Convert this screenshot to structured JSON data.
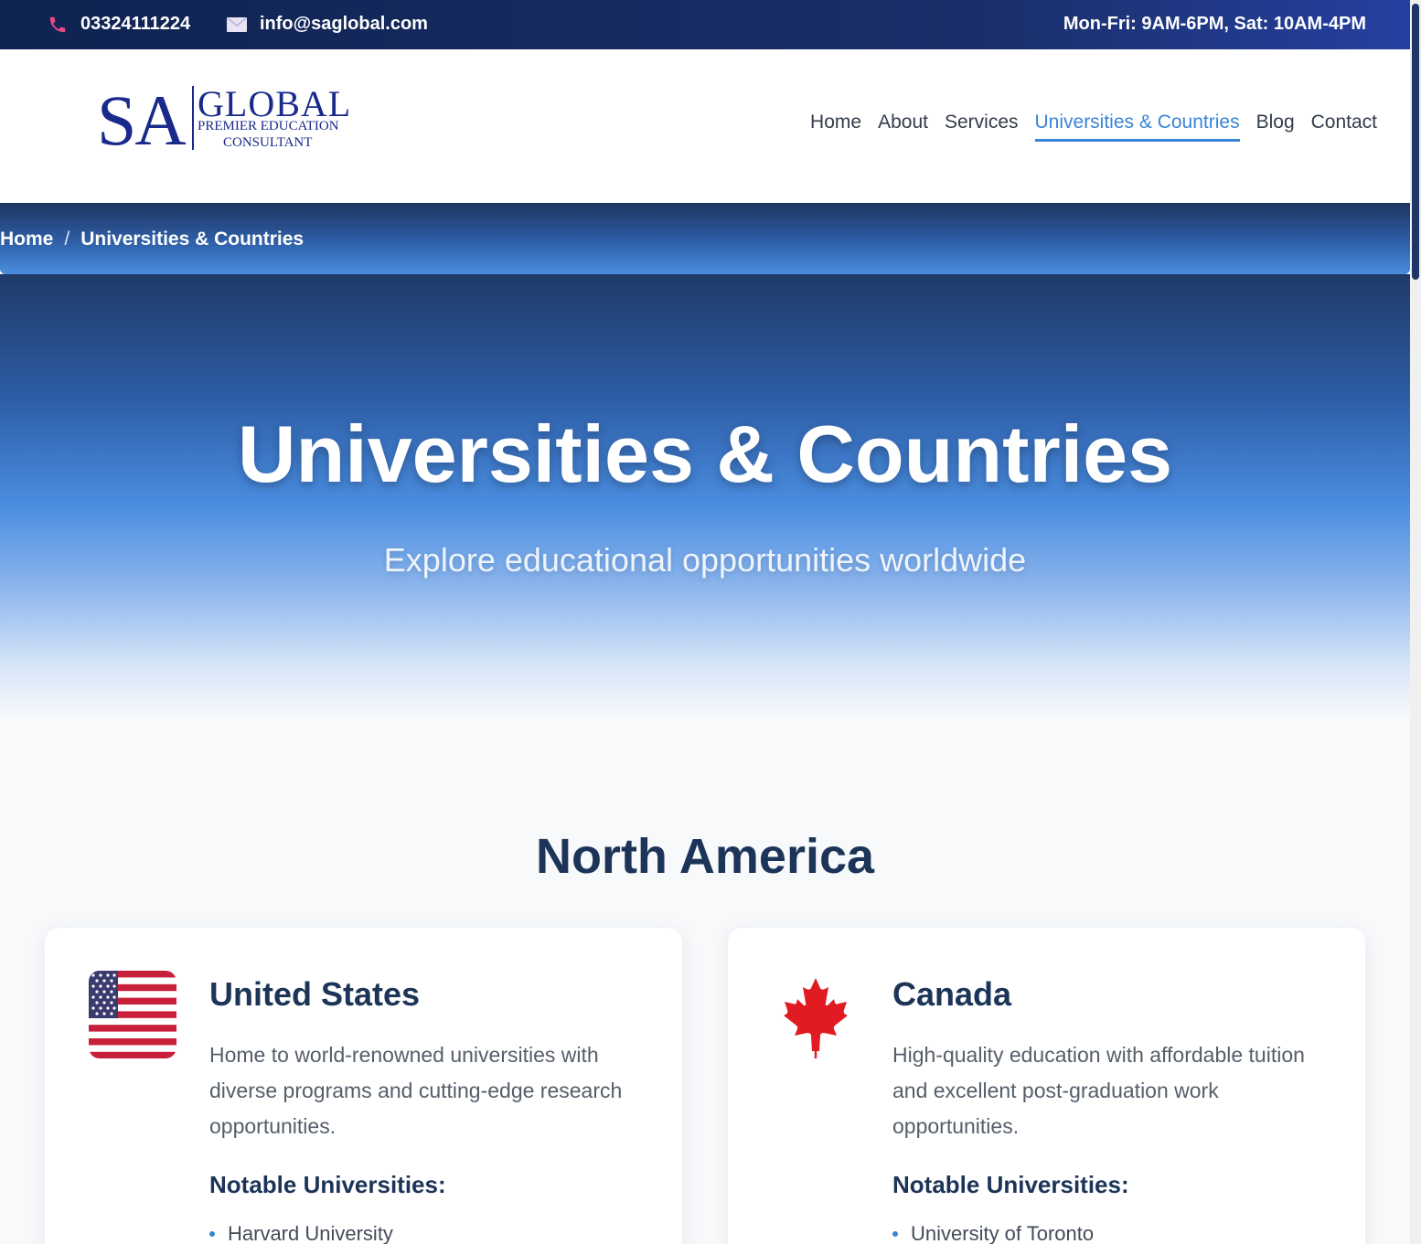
{
  "topbar": {
    "phone": "03324111224",
    "email": "info@saglobal.com",
    "hours": "Mon-Fri: 9AM-6PM, Sat: 10AM-4PM"
  },
  "logo": {
    "sa": "SA",
    "global": "GLOBAL",
    "line1": "PREMIER EDUCATION",
    "line2": "CONSULTANT"
  },
  "nav": {
    "items": [
      "Home",
      "About",
      "Services",
      "Universities & Countries",
      "Blog",
      "Contact"
    ],
    "active": "Universities & Countries"
  },
  "breadcrumb": {
    "home": "Home",
    "separator": "/",
    "current": "Universities & Countries"
  },
  "hero": {
    "title": "Universities & Countries",
    "subtitle": "Explore educational opportunities worldwide"
  },
  "section": {
    "title": "North America"
  },
  "cards": [
    {
      "country": "United States",
      "flag_icon": "us-flag-icon",
      "description": "Home to world-renowned universities with diverse programs and cutting-edge research opportunities.",
      "notable_label": "Notable Universities:",
      "universities": [
        "Harvard University"
      ]
    },
    {
      "country": "Canada",
      "flag_icon": "maple-leaf-icon",
      "description": "High-quality education with affordable tuition and excellent post-graduation work opportunities.",
      "notable_label": "Notable Universities:",
      "universities": [
        "University of Toronto"
      ]
    }
  ],
  "colors": {
    "accent": "#3a84d8",
    "navy": "#1c3458",
    "topbar": "#1a2f6a"
  }
}
